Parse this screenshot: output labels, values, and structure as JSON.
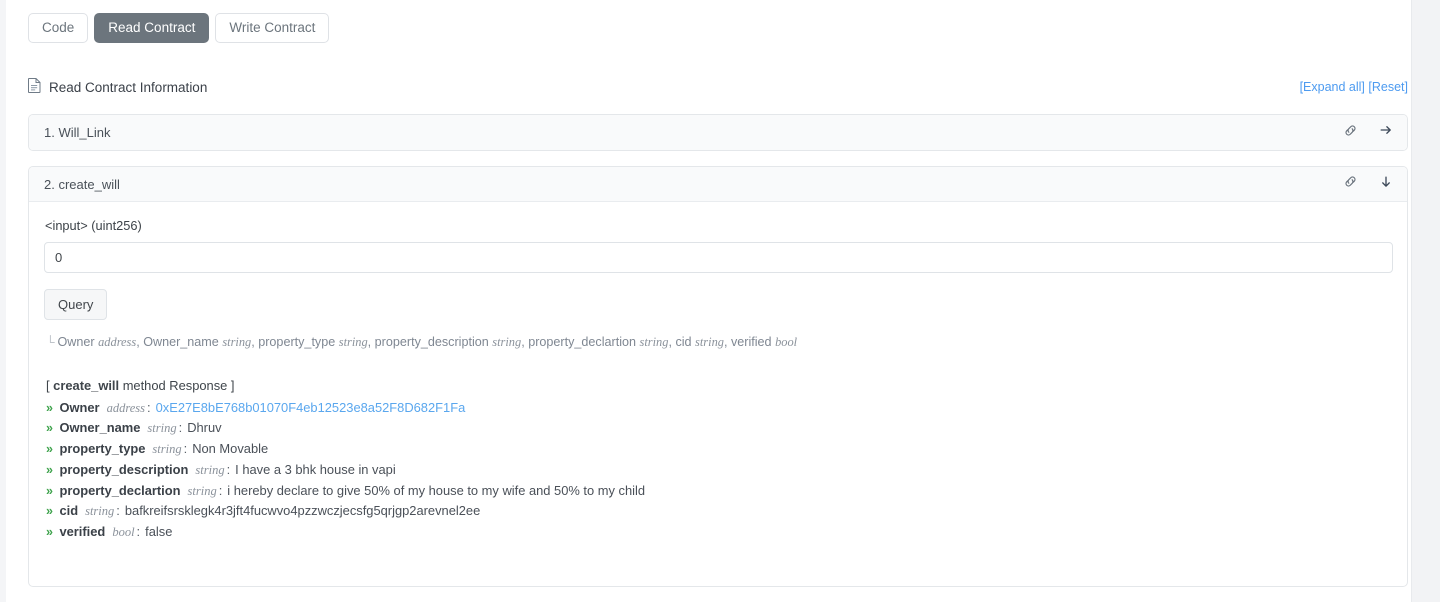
{
  "tabs": [
    {
      "label": "Code",
      "active": false,
      "name": "tab-code"
    },
    {
      "label": "Read Contract",
      "active": true,
      "name": "tab-read-contract"
    },
    {
      "label": "Write Contract",
      "active": false,
      "name": "tab-write-contract"
    }
  ],
  "section": {
    "title": "Read Contract Information",
    "icon": "document-icon",
    "expand_all": "[Expand all]",
    "reset": "[Reset]"
  },
  "methods": [
    {
      "title": "1. Will_Link",
      "expanded": false,
      "link_icon": "link-icon",
      "toggle_icon": "arrow-right-icon"
    },
    {
      "title": "2. create_will",
      "expanded": true,
      "link_icon": "link-icon",
      "toggle_icon": "arrow-down-icon"
    }
  ],
  "form": {
    "input_label": "<input> (uint256)",
    "input_value": "0",
    "input_placeholder": "",
    "query_button": "Query",
    "signature_corner": "└",
    "signature_parts": [
      {
        "name": "Owner",
        "type": "address",
        "sep": ", "
      },
      {
        "name": "Owner_name",
        "type": "string",
        "sep": ", "
      },
      {
        "name": "property_type",
        "type": "string",
        "sep": ", "
      },
      {
        "name": "property_description",
        "type": "string",
        "sep": ", "
      },
      {
        "name": "property_declartion",
        "type": "string",
        "sep": ", "
      },
      {
        "name": "cid",
        "type": "string",
        "sep": ", "
      },
      {
        "name": "verified",
        "type": "bool",
        "sep": ""
      }
    ]
  },
  "response": {
    "header_prefix": "[ ",
    "header_method": "create_will",
    "header_suffix": " method Response ]",
    "chevron": "»",
    "rows": [
      {
        "name": "Owner",
        "type": "address",
        "value": "0xE27E8bE768b01070F4eb12523e8a52F8D682F1Fa",
        "is_address": true
      },
      {
        "name": "Owner_name",
        "type": "string",
        "value": "Dhruv",
        "is_address": false
      },
      {
        "name": "property_type",
        "type": "string",
        "value": "Non Movable",
        "is_address": false
      },
      {
        "name": "property_description",
        "type": "string",
        "value": "I have a 3 bhk house in vapi",
        "is_address": false
      },
      {
        "name": "property_declartion",
        "type": "string",
        "value": "i hereby declare to give 50% of my house to my wife and 50% to my child",
        "is_address": false
      },
      {
        "name": "cid",
        "type": "string",
        "value": "bafkreifsrsklegk4r3jft4fucwvo4pzzwczjecsfg5qrjgp2arevnel2ee",
        "is_address": false
      },
      {
        "name": "verified",
        "type": "bool",
        "value": "false",
        "is_address": false
      }
    ]
  },
  "colors": {
    "active_tab_bg": "#6c757d",
    "link_blue": "#4d9bf0",
    "address_blue": "#5aa7ee",
    "chevron_green": "#3fa34d",
    "card_border": "#e4e7ea",
    "card_head_bg": "#f9fafb"
  }
}
